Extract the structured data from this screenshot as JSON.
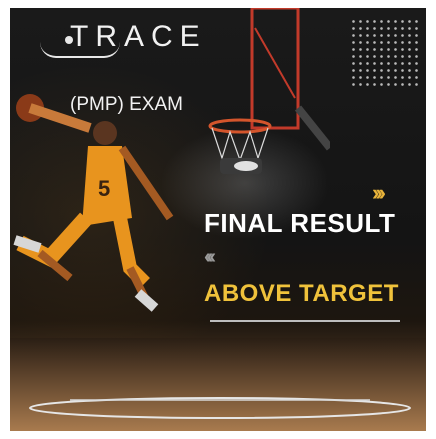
{
  "brand": {
    "logo_text": "TRACE"
  },
  "exam_label": "(PMP) EXAM",
  "headline": "FINAL RESULT",
  "subheadline": "ABOVE TARGET",
  "decor": {
    "chevrons_right": "›››",
    "chevrons_left": "‹‹‹"
  },
  "colors": {
    "accent": "#f0c23b",
    "background": "#161616",
    "text": "#ffffff"
  }
}
